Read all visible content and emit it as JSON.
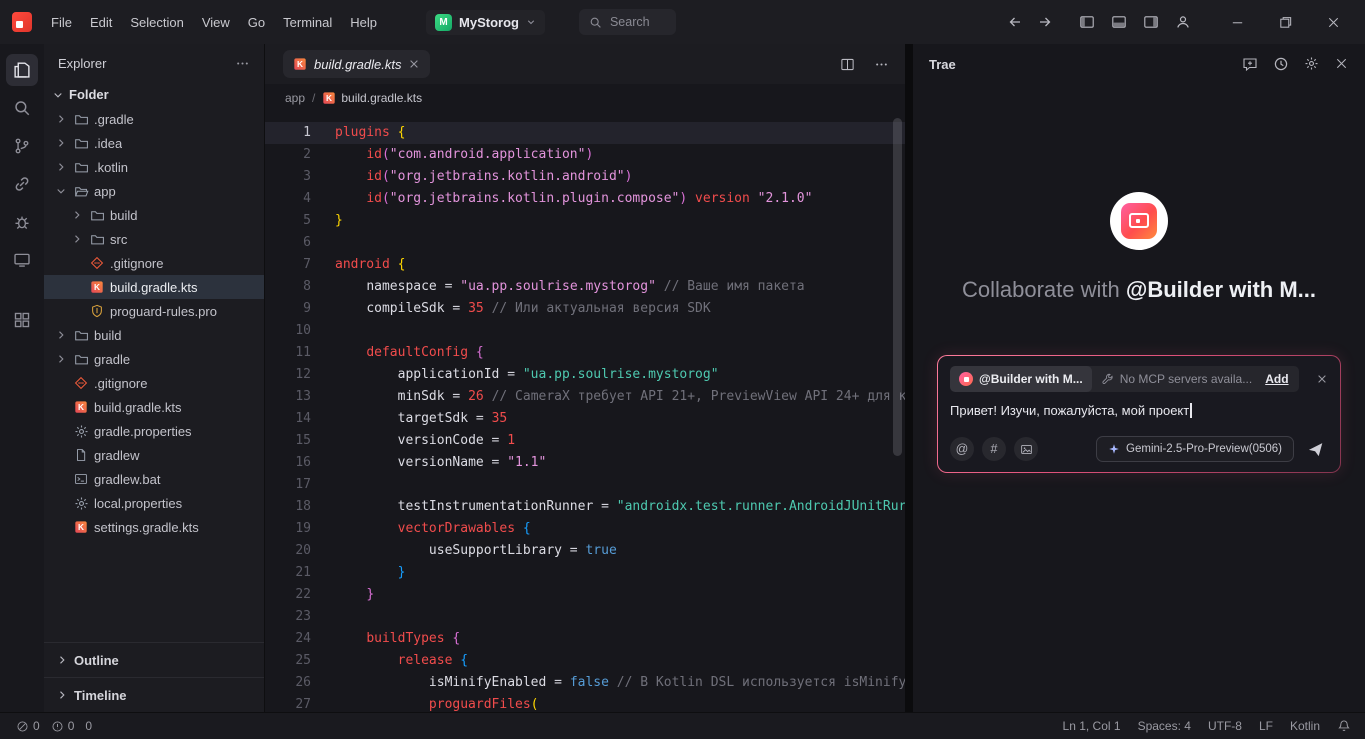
{
  "titlebar": {
    "menus": [
      "File",
      "Edit",
      "Selection",
      "View",
      "Go",
      "Terminal",
      "Help"
    ],
    "project_name": "MyStorog",
    "project_icon_letter": "M",
    "search_placeholder": "Search"
  },
  "activity_bar": [
    {
      "name": "explorer",
      "icon": "explorer",
      "active": true
    },
    {
      "name": "search",
      "icon": "search"
    },
    {
      "name": "source-control",
      "icon": "branch"
    },
    {
      "name": "remote",
      "icon": "link"
    },
    {
      "name": "debug",
      "icon": "bug"
    },
    {
      "name": "screen",
      "icon": "monitor"
    },
    {
      "name": "extensions",
      "icon": "extensions",
      "gap": true
    }
  ],
  "explorer": {
    "title": "Explorer",
    "section_label": "Folder",
    "tree": [
      {
        "label": ".gradle",
        "icon": "folder",
        "chevron": "right",
        "indent": 0
      },
      {
        "label": ".idea",
        "icon": "folder",
        "chevron": "right",
        "indent": 0
      },
      {
        "label": ".kotlin",
        "icon": "folder",
        "chevron": "right",
        "indent": 0
      },
      {
        "label": "app",
        "icon": "folderOpen",
        "chevron": "down",
        "indent": 0
      },
      {
        "label": "build",
        "icon": "folder",
        "chevron": "right",
        "indent": 1
      },
      {
        "label": "src",
        "icon": "folder",
        "chevron": "right",
        "indent": 1
      },
      {
        "label": ".gitignore",
        "icon": "git",
        "indent": 1
      },
      {
        "label": "build.gradle.kts",
        "icon": "kotlin",
        "indent": 1,
        "selected": true
      },
      {
        "label": "proguard-rules.pro",
        "icon": "shield",
        "indent": 1
      },
      {
        "label": "build",
        "icon": "folder",
        "chevron": "right",
        "indent": 0
      },
      {
        "label": "gradle",
        "icon": "folder",
        "chevron": "right",
        "indent": 0
      },
      {
        "label": ".gitignore",
        "icon": "git",
        "indent": 0
      },
      {
        "label": "build.gradle.kts",
        "icon": "kotlin",
        "indent": 0
      },
      {
        "label": "gradle.properties",
        "icon": "gear",
        "indent": 0
      },
      {
        "label": "gradlew",
        "icon": "file",
        "indent": 0
      },
      {
        "label": "gradlew.bat",
        "icon": "bat",
        "indent": 0
      },
      {
        "label": "local.properties",
        "icon": "gear",
        "indent": 0
      },
      {
        "label": "settings.gradle.kts",
        "icon": "kotlin",
        "indent": 0
      }
    ],
    "outline_label": "Outline",
    "timeline_label": "Timeline"
  },
  "editor": {
    "tab_label": "build.gradle.kts",
    "breadcrumb_folder": "app",
    "breadcrumb_sep": "/",
    "breadcrumb_file": "build.gradle.kts",
    "active_line": 1,
    "code": [
      {
        "n": 1,
        "tk": [
          {
            "t": "k",
            "s": "plugins"
          },
          {
            "t": "p",
            "s": " "
          },
          {
            "t": "1",
            "s": "{"
          }
        ]
      },
      {
        "n": 2,
        "tk": [
          {
            "t": "p",
            "s": "    "
          },
          {
            "t": "k",
            "s": "id"
          },
          {
            "t": "2",
            "s": "("
          },
          {
            "t": "s",
            "s": "\"com.android.application\""
          },
          {
            "t": "2",
            "s": ")"
          }
        ]
      },
      {
        "n": 3,
        "tk": [
          {
            "t": "p",
            "s": "    "
          },
          {
            "t": "k",
            "s": "id"
          },
          {
            "t": "2",
            "s": "("
          },
          {
            "t": "s",
            "s": "\"org.jetbrains.kotlin.android\""
          },
          {
            "t": "2",
            "s": ")"
          }
        ]
      },
      {
        "n": 4,
        "tk": [
          {
            "t": "p",
            "s": "    "
          },
          {
            "t": "k",
            "s": "id"
          },
          {
            "t": "2",
            "s": "("
          },
          {
            "t": "s",
            "s": "\"org.jetbrains.kotlin.plugin.compose\""
          },
          {
            "t": "2",
            "s": ")"
          },
          {
            "t": "p",
            "s": " "
          },
          {
            "t": "k",
            "s": "version"
          },
          {
            "t": "p",
            "s": " "
          },
          {
            "t": "s",
            "s": "\"2.1.0\""
          }
        ]
      },
      {
        "n": 5,
        "tk": [
          {
            "t": "1",
            "s": "}"
          }
        ]
      },
      {
        "n": 6,
        "tk": []
      },
      {
        "n": 7,
        "tk": [
          {
            "t": "k",
            "s": "android"
          },
          {
            "t": "p",
            "s": " "
          },
          {
            "t": "1",
            "s": "{"
          }
        ]
      },
      {
        "n": 8,
        "tk": [
          {
            "t": "p",
            "s": "    "
          },
          {
            "t": "r",
            "s": "namespace"
          },
          {
            "t": "p",
            "s": " = "
          },
          {
            "t": "s",
            "s": "\"ua.pp.soulrise.mystorog\""
          },
          {
            "t": "p",
            "s": " "
          },
          {
            "t": "c",
            "s": "// Ваше имя пакета"
          }
        ]
      },
      {
        "n": 9,
        "tk": [
          {
            "t": "p",
            "s": "    "
          },
          {
            "t": "r",
            "s": "compileSdk"
          },
          {
            "t": "p",
            "s": " = "
          },
          {
            "t": "n",
            "s": "35"
          },
          {
            "t": "p",
            "s": " "
          },
          {
            "t": "c",
            "s": "// Или актуальная версия SDK"
          }
        ]
      },
      {
        "n": 10,
        "tk": []
      },
      {
        "n": 11,
        "tk": [
          {
            "t": "p",
            "s": "    "
          },
          {
            "t": "k",
            "s": "defaultConfig"
          },
          {
            "t": "p",
            "s": " "
          },
          {
            "t": "2",
            "s": "{"
          }
        ]
      },
      {
        "n": 12,
        "tk": [
          {
            "t": "p",
            "s": "        "
          },
          {
            "t": "r",
            "s": "applicationId"
          },
          {
            "t": "p",
            "s": " = "
          },
          {
            "t": "g",
            "s": "\"ua.pp.soulrise.mystorog\""
          }
        ]
      },
      {
        "n": 13,
        "tk": [
          {
            "t": "p",
            "s": "        "
          },
          {
            "t": "r",
            "s": "minSdk"
          },
          {
            "t": "p",
            "s": " = "
          },
          {
            "t": "n",
            "s": "26"
          },
          {
            "t": "p",
            "s": " "
          },
          {
            "t": "c",
            "s": "// CameraX требует API 21+, PreviewView API 24+ для к"
          }
        ]
      },
      {
        "n": 14,
        "tk": [
          {
            "t": "p",
            "s": "        "
          },
          {
            "t": "r",
            "s": "targetSdk"
          },
          {
            "t": "p",
            "s": " = "
          },
          {
            "t": "n",
            "s": "35"
          }
        ]
      },
      {
        "n": 15,
        "tk": [
          {
            "t": "p",
            "s": "        "
          },
          {
            "t": "r",
            "s": "versionCode"
          },
          {
            "t": "p",
            "s": " = "
          },
          {
            "t": "n",
            "s": "1"
          }
        ]
      },
      {
        "n": 16,
        "tk": [
          {
            "t": "p",
            "s": "        "
          },
          {
            "t": "r",
            "s": "versionName"
          },
          {
            "t": "p",
            "s": " = "
          },
          {
            "t": "s",
            "s": "\"1.1\""
          }
        ]
      },
      {
        "n": 17,
        "tk": []
      },
      {
        "n": 18,
        "tk": [
          {
            "t": "p",
            "s": "        "
          },
          {
            "t": "r",
            "s": "testInstrumentationRunner"
          },
          {
            "t": "p",
            "s": " = "
          },
          {
            "t": "g",
            "s": "\"androidx.test.runner.AndroidJUnitRur"
          }
        ]
      },
      {
        "n": 19,
        "tk": [
          {
            "t": "p",
            "s": "        "
          },
          {
            "t": "k",
            "s": "vectorDrawables"
          },
          {
            "t": "p",
            "s": " "
          },
          {
            "t": "3",
            "s": "{"
          }
        ]
      },
      {
        "n": 20,
        "tk": [
          {
            "t": "p",
            "s": "            "
          },
          {
            "t": "r",
            "s": "useSupportLibrary"
          },
          {
            "t": "p",
            "s": " = "
          },
          {
            "t": "b",
            "s": "true"
          }
        ]
      },
      {
        "n": 21,
        "tk": [
          {
            "t": "p",
            "s": "        "
          },
          {
            "t": "3",
            "s": "}"
          }
        ]
      },
      {
        "n": 22,
        "tk": [
          {
            "t": "p",
            "s": "    "
          },
          {
            "t": "2",
            "s": "}"
          }
        ]
      },
      {
        "n": 23,
        "tk": []
      },
      {
        "n": 24,
        "tk": [
          {
            "t": "p",
            "s": "    "
          },
          {
            "t": "k",
            "s": "buildTypes"
          },
          {
            "t": "p",
            "s": " "
          },
          {
            "t": "2",
            "s": "{"
          }
        ]
      },
      {
        "n": 25,
        "tk": [
          {
            "t": "p",
            "s": "        "
          },
          {
            "t": "k",
            "s": "release"
          },
          {
            "t": "p",
            "s": " "
          },
          {
            "t": "3",
            "s": "{"
          }
        ]
      },
      {
        "n": 26,
        "tk": [
          {
            "t": "p",
            "s": "            "
          },
          {
            "t": "r",
            "s": "isMinifyEnabled"
          },
          {
            "t": "p",
            "s": " = "
          },
          {
            "t": "b",
            "s": "false"
          },
          {
            "t": "p",
            "s": " "
          },
          {
            "t": "c",
            "s": "// В Kotlin DSL используется isMinify"
          }
        ]
      },
      {
        "n": 27,
        "tk": [
          {
            "t": "p",
            "s": "            "
          },
          {
            "t": "k",
            "s": "proguardFiles"
          },
          {
            "t": "1",
            "s": "("
          }
        ]
      }
    ]
  },
  "ai_panel": {
    "title": "Trae",
    "heading_prefix": "Collaborate with ",
    "heading_mention": "@Builder with M...",
    "agent_badge": "@Builder with M...",
    "mcp_status": "No MCP servers availa...",
    "add_label": "Add",
    "input_text": "Привет! Изучи, пожалуйста, мой проект",
    "tool_at": "@",
    "tool_hash": "#",
    "model_label": "Gemini-2.5-Pro-Preview(0506)"
  },
  "status_bar": {
    "errors": "0",
    "warnings": "0",
    "extra": "0",
    "cursor": "Ln 1, Col 1",
    "spaces": "Spaces: 4",
    "encoding": "UTF-8",
    "eol": "LF",
    "language": "Kotlin"
  }
}
